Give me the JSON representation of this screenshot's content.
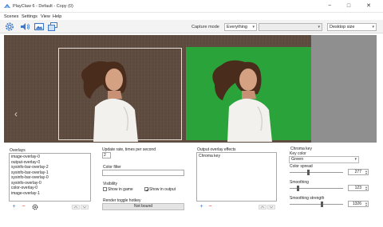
{
  "window": {
    "title": "PlayClaw 6 - Default - Copy (0)",
    "controls": {
      "minimize": "−",
      "maximize": "□",
      "close": "✕"
    }
  },
  "menu": [
    "Scenes",
    "Settings",
    "View",
    "Help"
  ],
  "toolbar": {
    "icons": [
      "gear-icon",
      "speaker-icon",
      "image-icon",
      "layers-icon"
    ],
    "capture_mode_label": "Capture mode",
    "capture_mode_value": "Everything",
    "capture_target_value": "",
    "size_value": "Desktop size"
  },
  "preview": {
    "nav_prev": "‹",
    "colors": {
      "background": "#5b4a3d",
      "green_screen": "#29a33a",
      "side": "#8f8f8f"
    }
  },
  "overlays": {
    "label": "Overlays",
    "items": [
      "image-overlay-0",
      "output-overlay-0",
      "sysinfo-bar-overlay-2",
      "sysinfo-bar-overlay-1",
      "sysinfo-bar-overlay-0",
      "sysinfo-overlay-0",
      "color-overlay-0",
      "image-overlay-1"
    ],
    "add": "+",
    "remove": "−",
    "settings_icon": "gear-icon"
  },
  "update": {
    "label": "Update rate, times per second",
    "rate": "2",
    "color_filter_label": "Color filter",
    "visibility_label": "Visibility",
    "show_in_game": "Show in game",
    "show_in_game_checked": false,
    "show_in_output": "Show in output",
    "show_in_output_checked": true,
    "hotkey_label": "Render toggle hotkey",
    "hotkey_value": "Not bound"
  },
  "effects": {
    "label": "Output overlay effects",
    "items": [
      "Chroma key"
    ],
    "add": "+",
    "remove": "−"
  },
  "chroma": {
    "label": "Chroma key",
    "key_color_label": "Key color",
    "key_color_value": "Green",
    "spread_label": "Color spread",
    "spread_value": "277",
    "spread_level": 0.35,
    "smoothing_label": "Smoothing",
    "smoothing_value": "123",
    "smoothing_level": 0.15,
    "strength_label": "Smoothing strength",
    "strength_value": "1326",
    "strength_level": 0.6
  }
}
